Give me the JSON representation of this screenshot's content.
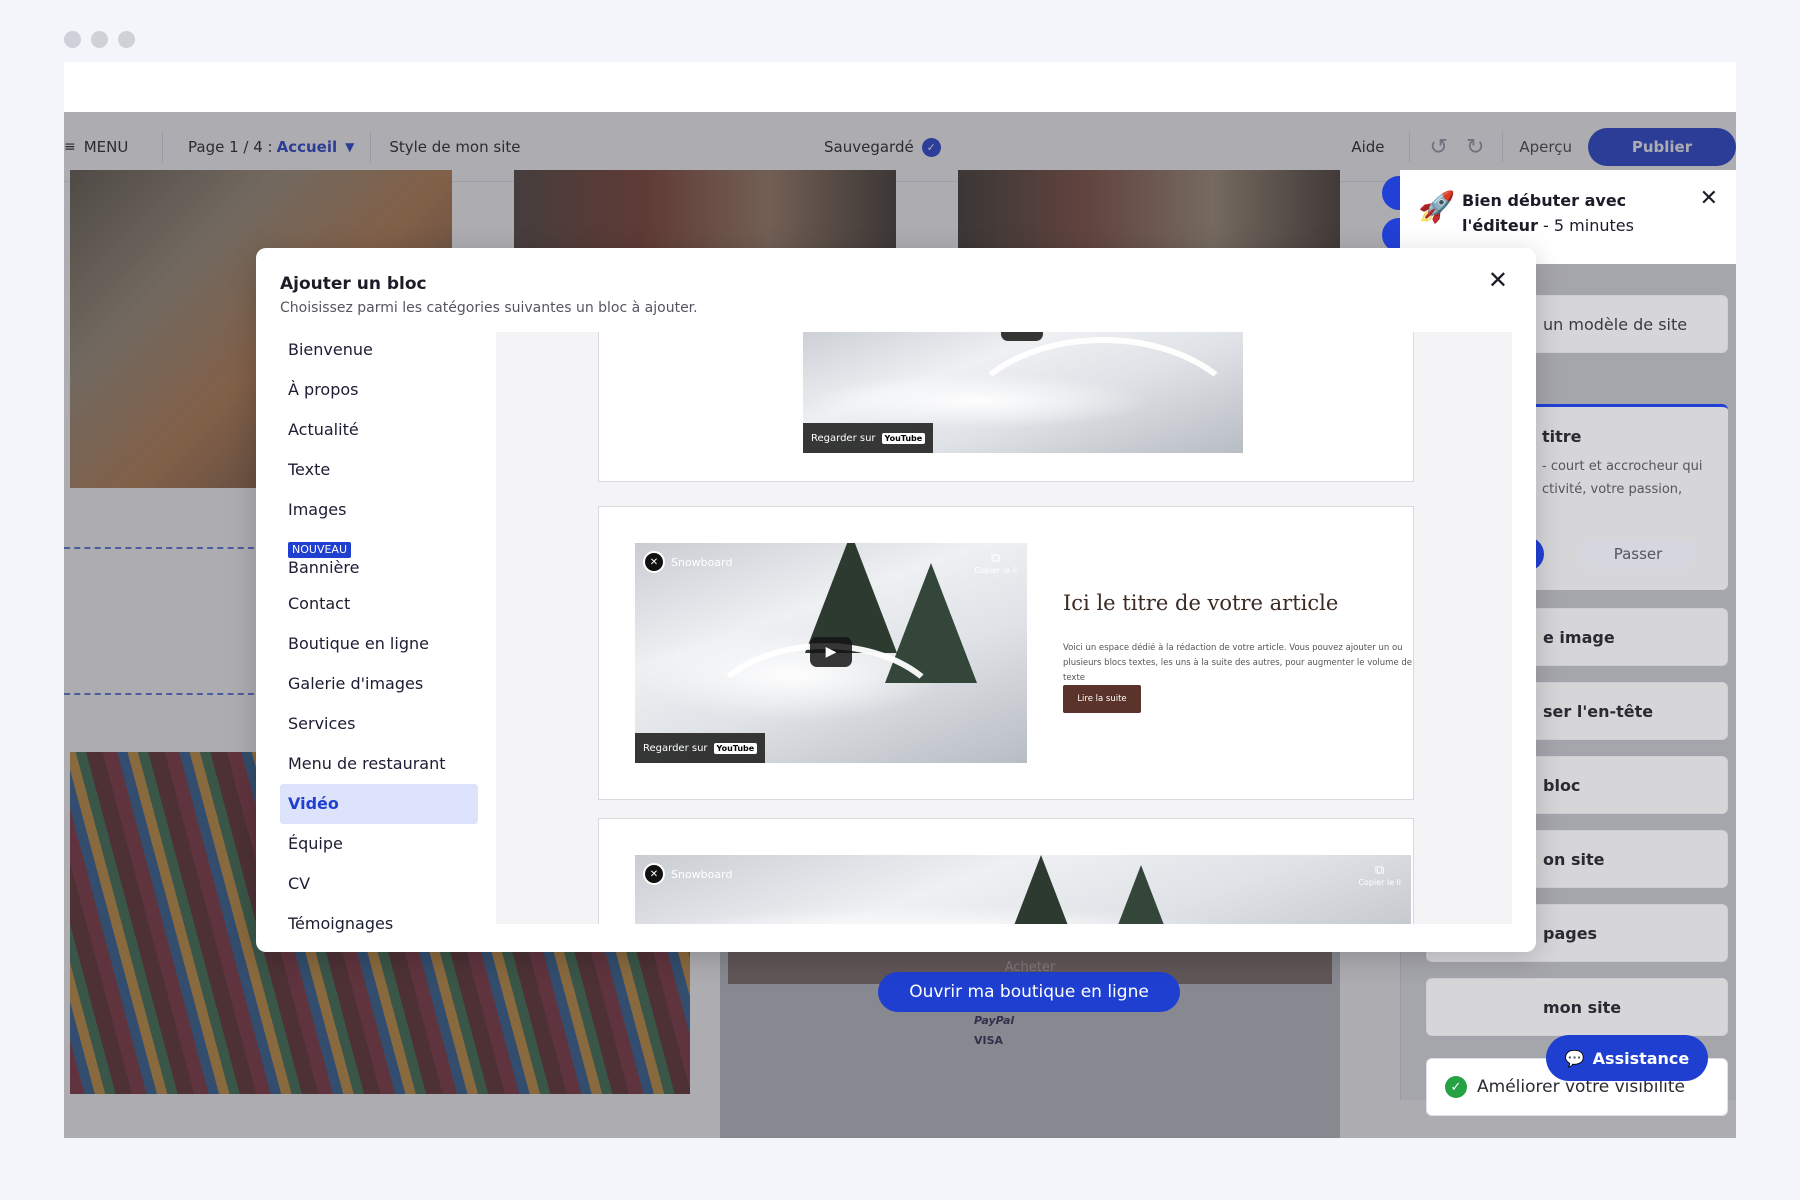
{
  "topbar": {
    "menu_label": "MENU",
    "page_prefix": "Page 1 / 4 :",
    "page_name": "Accueil",
    "style_label": "Style de mon site",
    "saved_label": "Sauvegardé",
    "help_label": "Aide",
    "preview_label": "Aperçu",
    "publish_label": "Publier"
  },
  "shop": {
    "buy_label": "Acheter",
    "open_shop_label": "Ouvrir ma boutique en ligne",
    "paypal_label": "PayPal",
    "visa_label": "VISA"
  },
  "onboarding": {
    "title_bold": "Bien débuter avec l'éditeur",
    "title_light": " - 5 minutes",
    "items": [
      {
        "label": "un modèle de site"
      },
      {
        "label": "e image"
      },
      {
        "label": "ser l'en-tête"
      },
      {
        "label": "bloc"
      },
      {
        "label": "on site"
      },
      {
        "label": "pages"
      },
      {
        "label": "mon site"
      }
    ],
    "active_card": {
      "title": "titre",
      "desc": "- court et accrocheur qui ctivité, votre passion,",
      "skip_label": "Passer"
    },
    "visibility_label": "Améliorer votre visibilité"
  },
  "assistance_label": "Assistance",
  "modal": {
    "title": "Ajouter un bloc",
    "subtitle": "Choisissez parmi les catégories suivantes un bloc à ajouter.",
    "new_badge": "NOUVEAU",
    "categories": [
      "Bienvenue",
      "À propos",
      "Actualité",
      "Texte",
      "Images",
      "Bannière",
      "Contact",
      "Boutique en ligne",
      "Galerie d'images",
      "Services",
      "Menu de restaurant",
      "Vidéo",
      "Équipe",
      "CV",
      "Témoignages"
    ],
    "active_category": "Vidéo"
  },
  "video": {
    "watch_on": "Regarder sur",
    "youtube": "YouTube",
    "channel": "Snowboard",
    "copy_link": "Copier le li"
  },
  "article": {
    "title": "Ici le titre de votre article",
    "text": "Voici un espace dédié à la rédaction de votre article. Vous pouvez ajouter un ou plusieurs blocs textes, les uns à la suite des autres, pour augmenter le volume de texte",
    "button": "Lire la suite"
  },
  "colors": {
    "accent": "#1f3fd1",
    "success": "#25a244",
    "article_button": "#5a342a"
  },
  "icons": [
    "hamburger-icon",
    "chevron-down-icon",
    "check-badge-icon",
    "undo-icon",
    "redo-icon",
    "rocket-icon",
    "close-icon",
    "chat-icon",
    "play-icon",
    "copy-icon"
  ]
}
